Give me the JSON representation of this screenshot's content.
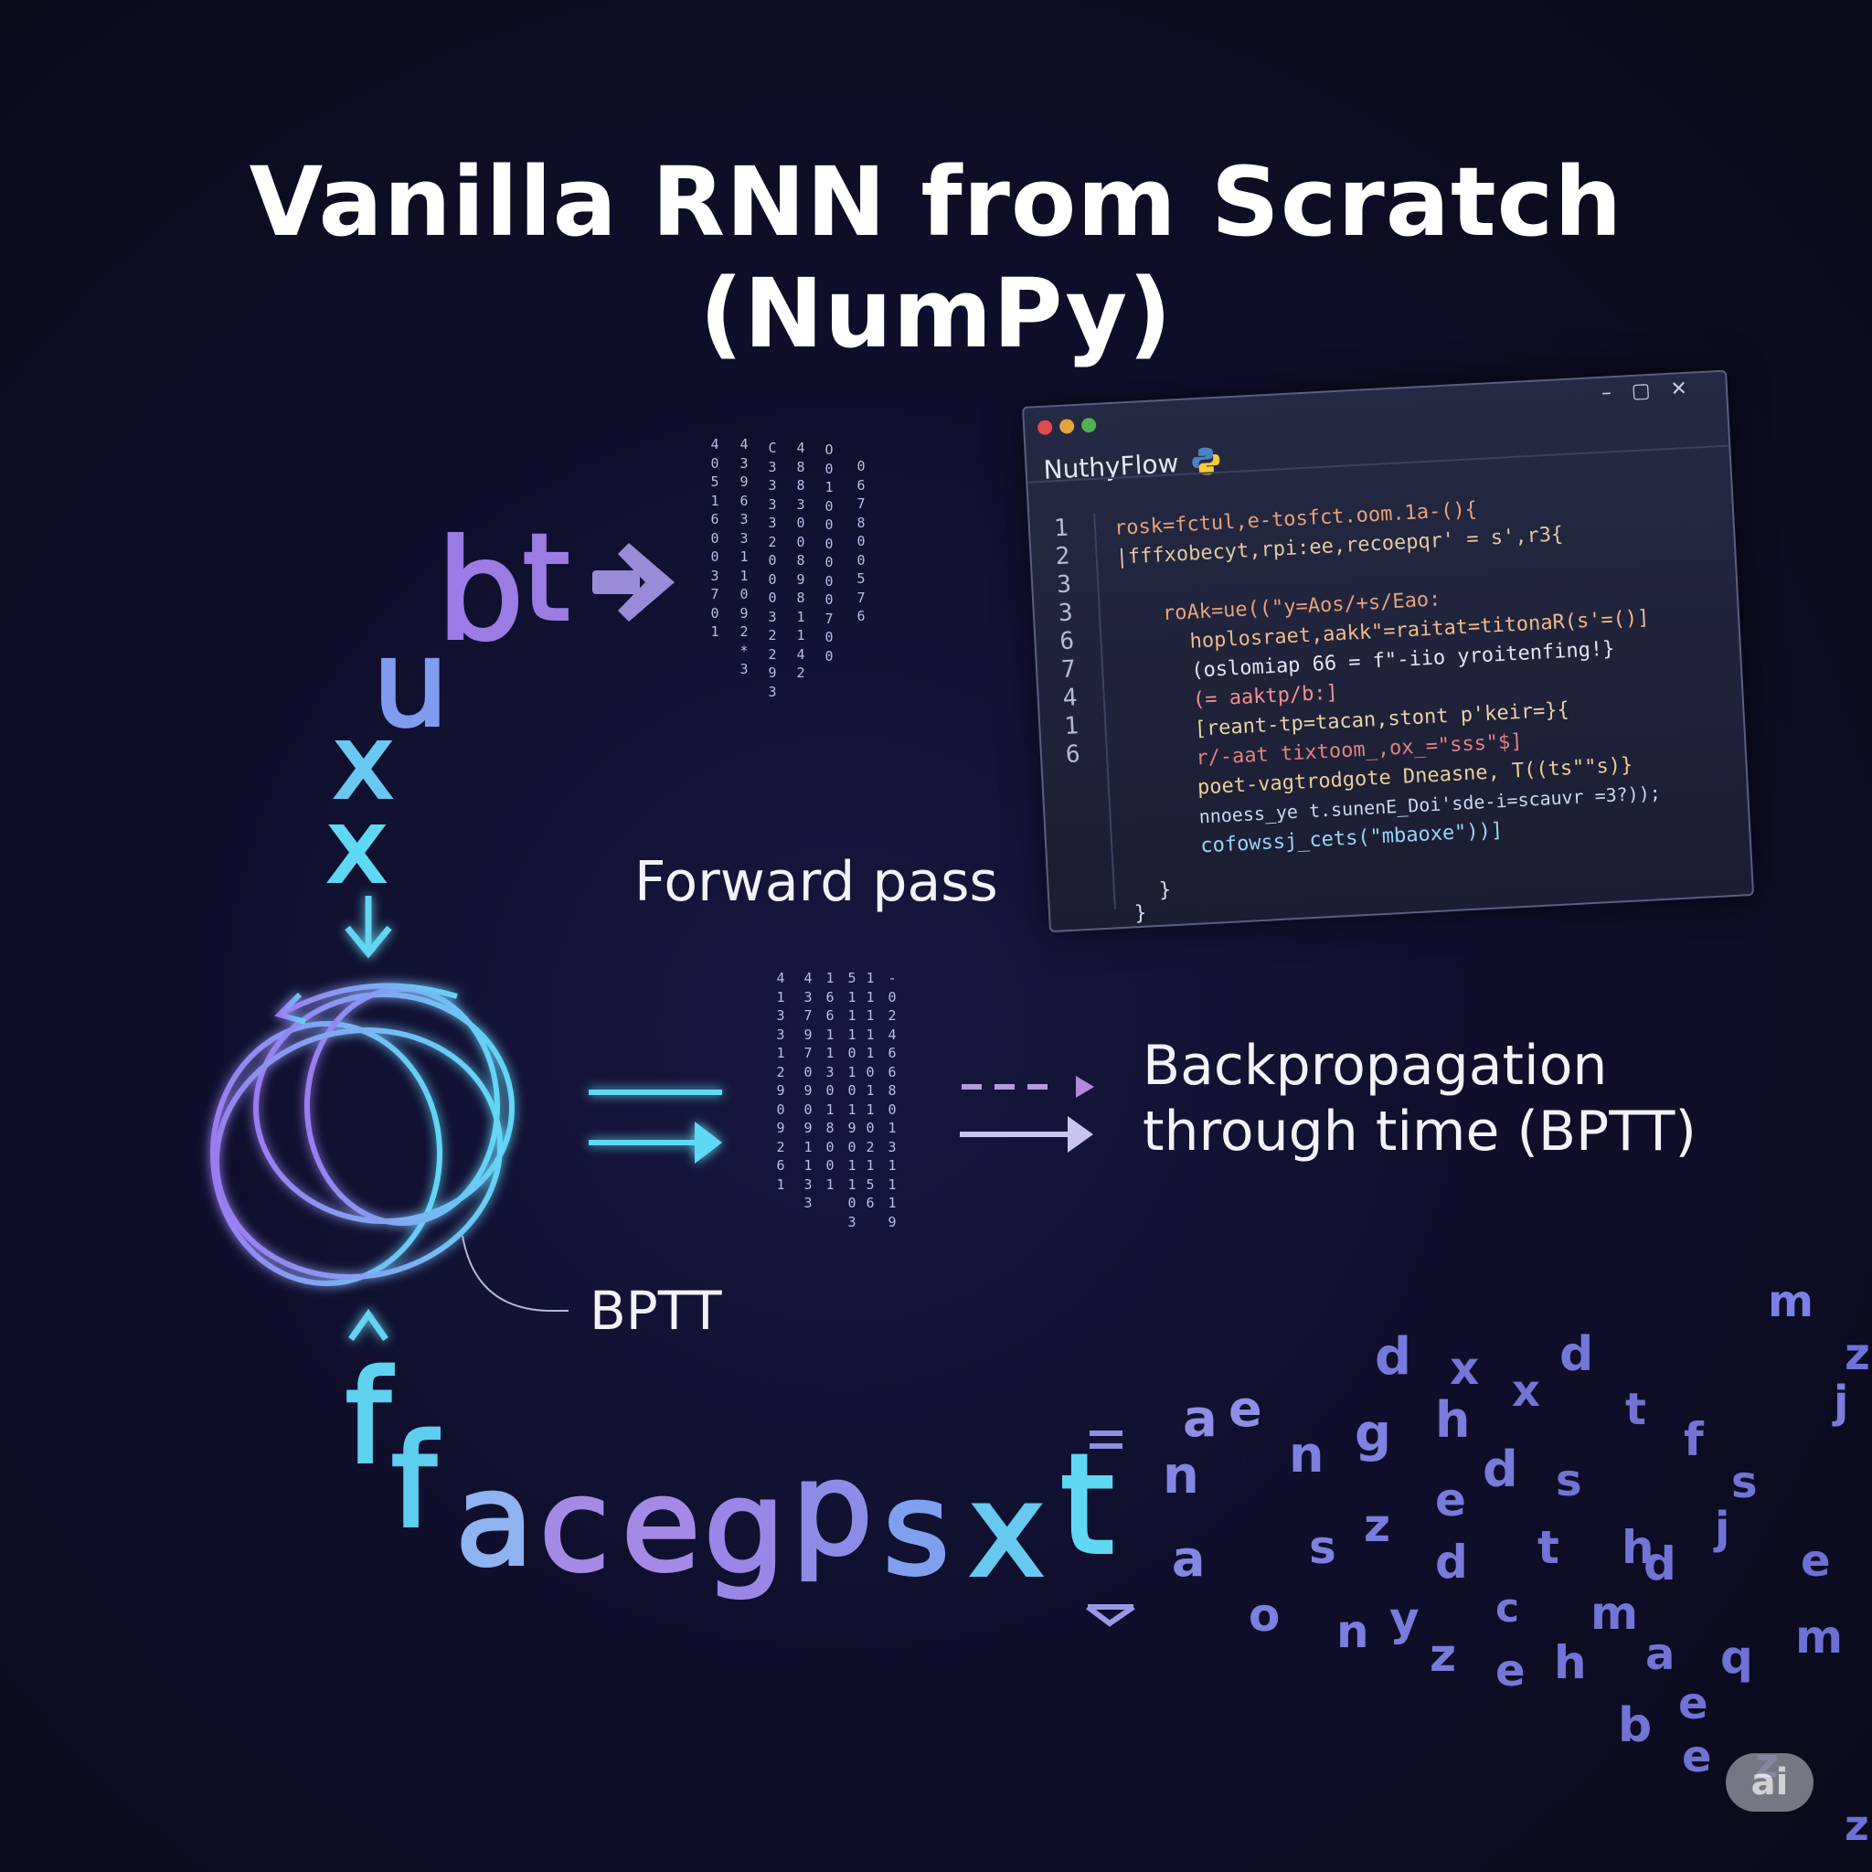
{
  "title": "Vanilla RNN from Scratch (NumPy)",
  "labels": {
    "forward_pass": "Forward pass",
    "bptt_line1": "Backpropagation",
    "bptt_line2": "through time (BPTT)",
    "bptt_short": "BPTT"
  },
  "input_letters": [
    "b",
    "t",
    "u",
    "x",
    "x"
  ],
  "output_letters": [
    "f",
    "f",
    "a",
    "c",
    "e",
    "g",
    "p",
    "s",
    "x",
    "t"
  ],
  "scatter_letters": [
    "m",
    "z",
    "j",
    "d",
    "x",
    "d",
    "x",
    "t",
    "f",
    "a",
    "e",
    "g",
    "h",
    "n",
    "n",
    "d",
    "s",
    "j",
    "s",
    "e",
    "z",
    "e",
    "d",
    "t",
    "h",
    "d",
    "a",
    "s",
    "a",
    "c",
    "m",
    "o",
    "n",
    "y",
    "z",
    "e",
    "h",
    "a",
    "q",
    "m",
    "b",
    "e",
    "e",
    "z",
    "z",
    "n"
  ],
  "code_window": {
    "app_name": "NuthyFlow",
    "line_numbers": [
      "1",
      "2",
      "3",
      "3",
      "6",
      "7",
      "4",
      "1",
      "6"
    ],
    "code_lines": [
      "rosk=fctul,e-tosfct.oom.1a-(){",
      "|fffxobecyt,rpi:ee,recoepqr' = s',r3{",
      "roAk=ue((\"y=Aos/+s/Eao:",
      "hoplosraet,aakk\"=raitat=titonaR(s'=()]",
      "(oslomiap 66 = f\"-iio yroitenfing!}",
      "(= aaktp/b:]",
      "[reant-tp=tacan,stont p'keir=}{",
      "r/-aat tixtoom_,ox_=\"sss\"$]",
      "poet-vagtrodgote Dneasne, T((ts\"\"s)}",
      "nnoess_ye t.sunenE_Doi'sde-i=scauvr =3?));",
      "cofowssj_cets(\"mbaoxe\"))]",
      "}",
      "}"
    ]
  },
  "digit_columns_top": [
    "4\n0\n5\n1\n6\n0\n0\n3\n7\n0\n1",
    "4\n3\n9\n6\n3\n3\n1\n1\n0\n9\n2\n*\n3",
    "C\n3\n3\n3\n3\n2\n0\n0\n0\n3\n2\n2\n9\n3",
    "4\n8\n8\n3\n0\n0\n8\n9\n8\n1\n1\n4\n2",
    "O\n0\n1\n0\n0\n0\n0\n0\n0\n7\n0\n0",
    "0\n6\n7\n8\n0\n0\n5\n7\n6"
  ],
  "digit_columns_mid": [
    "4\n1\n3\n3\n1\n2\n9\n0\n9\n2\n6\n1",
    "4\n3\n7\n9\n7\n0\n9\n0\n9\n1\n1\n3\n3",
    "1\n6\n6\n1\n1\n3\n0\n1\n8\n0\n0\n1",
    "5\n1\n1\n1\n0\n1\n0\n1\n9\n0\n1\n1\n0\n3",
    "1\n1\n1\n1\n1\n0\n1\n1\n0\n2\n1\n5\n6",
    "-\n0\n2\n4\n6\n6\n8\n0\n1\n3\n1\n1\n1\n9"
  ],
  "colors": {
    "background": "#0f0f2c",
    "purple": "#9a7be0",
    "blue": "#7aa7f0",
    "cyan": "#5fd9f3",
    "loop": "#7d8cf0",
    "badge": "#8a8a96"
  },
  "badge": "ai"
}
